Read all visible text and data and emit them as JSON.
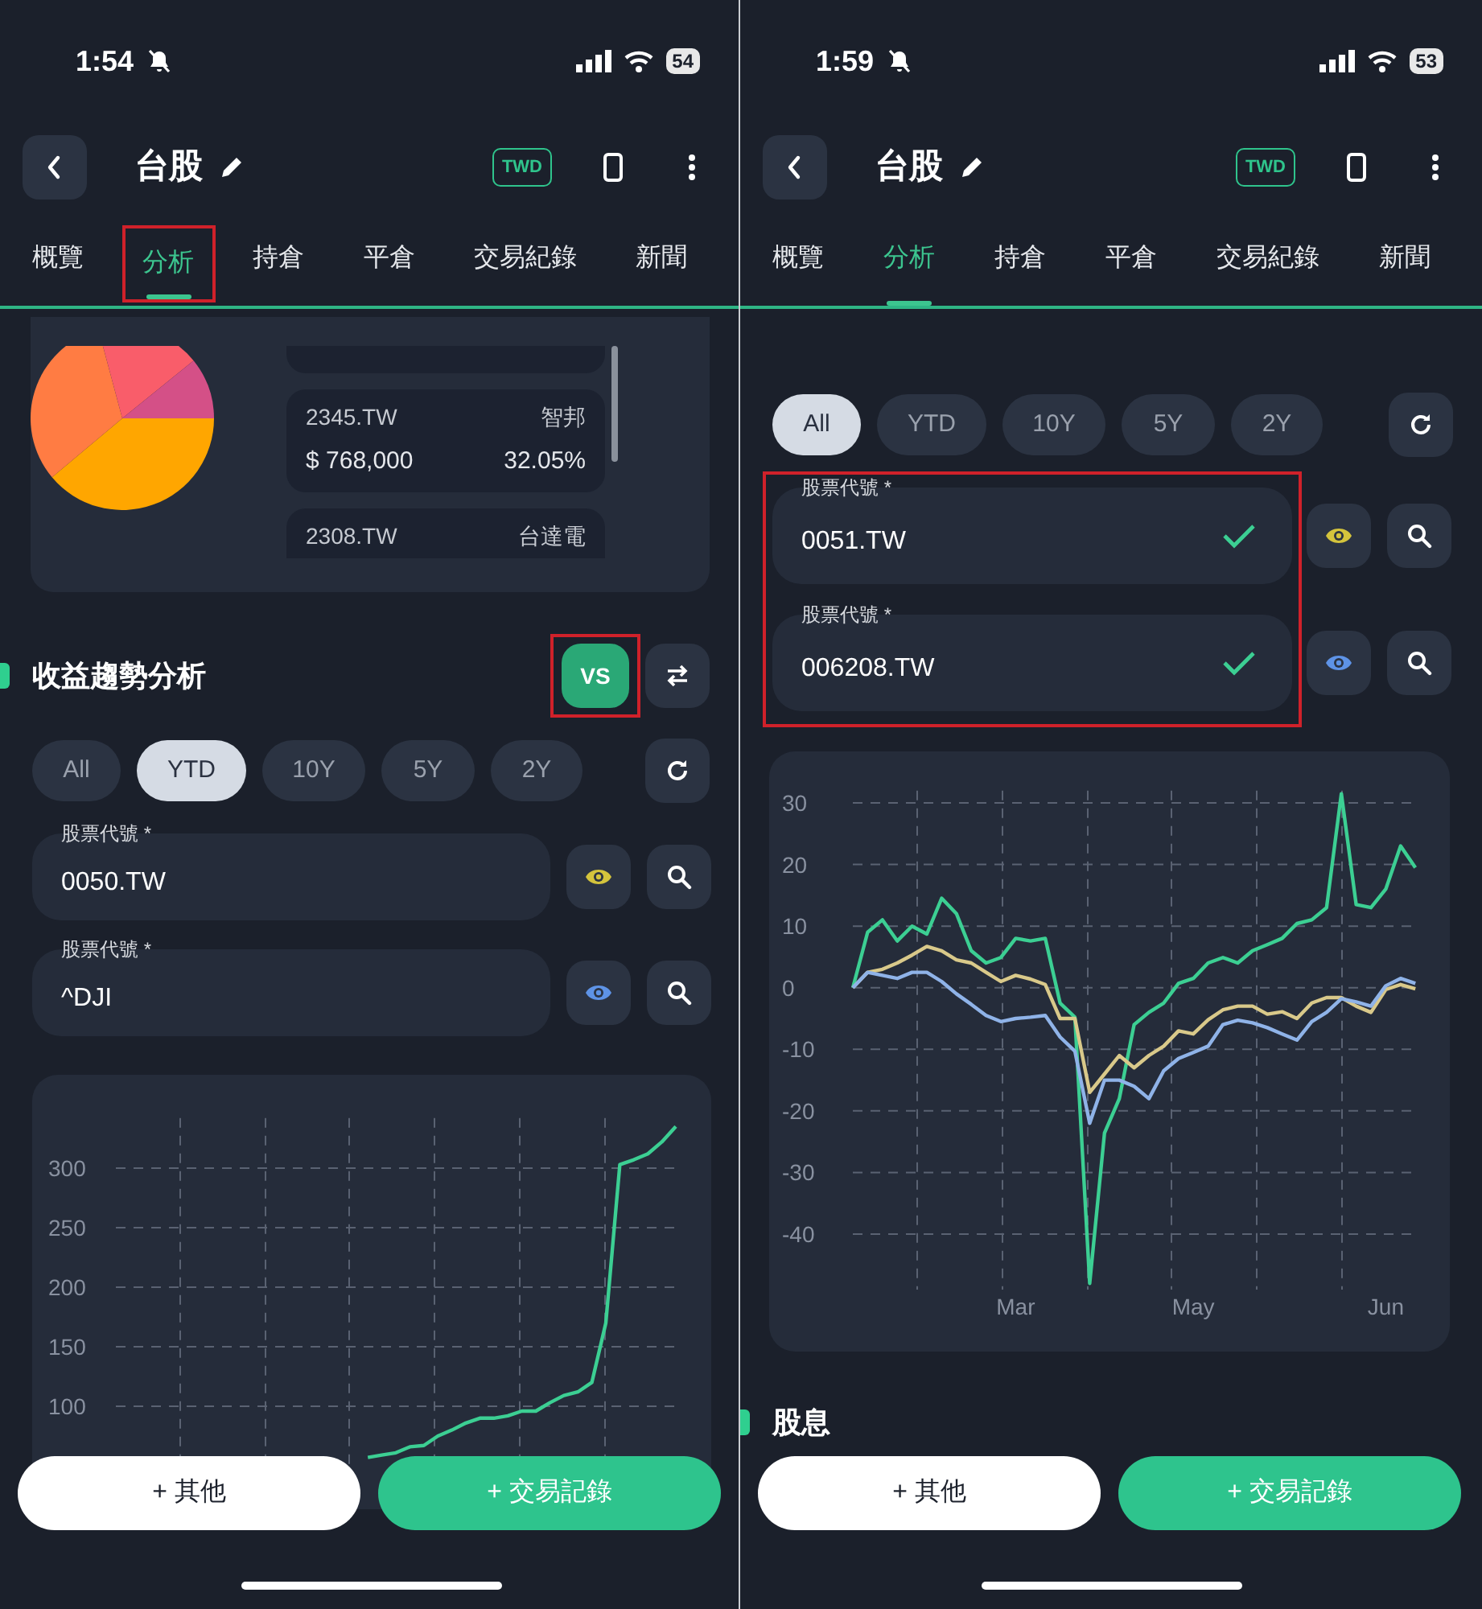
{
  "screens": [
    {
      "status_bar": {
        "time": "1:54",
        "battery": "54"
      },
      "header": {
        "title": "台股",
        "currency": "TWD"
      },
      "tabs": [
        {
          "label": "概覽",
          "selected": false,
          "highlighted": false
        },
        {
          "label": "分析",
          "selected": true,
          "highlighted": true
        },
        {
          "label": "持倉",
          "selected": false,
          "highlighted": false
        },
        {
          "label": "平倉",
          "selected": false,
          "highlighted": false
        },
        {
          "label": "交易紀錄",
          "selected": false,
          "highlighted": false
        },
        {
          "label": "新聞",
          "selected": false,
          "highlighted": false
        }
      ],
      "holdings": [
        {
          "symbol": "2345.TW",
          "name": "智邦",
          "amount": "$ 768,000",
          "percent": "32.05%"
        },
        {
          "symbol": "2308.TW",
          "name": "台達電"
        }
      ],
      "section_title": "收益趨勢分析",
      "vs_button": {
        "label": "VS",
        "on": true,
        "highlighted": true
      },
      "ranges": [
        {
          "label": "All",
          "selected": false
        },
        {
          "label": "YTD",
          "selected": true
        },
        {
          "label": "10Y",
          "selected": false
        },
        {
          "label": "5Y",
          "selected": false
        },
        {
          "label": "2Y",
          "selected": false
        }
      ],
      "tickers_highlighted": false,
      "tickers": [
        {
          "label": "股票代號 *",
          "value": "0050.TW",
          "verified": false,
          "color": "#d4c43c"
        },
        {
          "label": "股票代號 *",
          "value": "^DJI",
          "verified": false,
          "color": "#5e93e6"
        }
      ],
      "chart": {
        "chart_data": {
          "type": "line",
          "categories": [
            null,
            null,
            null,
            null,
            null,
            null,
            null,
            null,
            null,
            null,
            null,
            null,
            null,
            null,
            null,
            null,
            null,
            null,
            null,
            null,
            null,
            null,
            null,
            null,
            null,
            null,
            null,
            null,
            null,
            null,
            null,
            null,
            null,
            null,
            null,
            null,
            null,
            null,
            null,
            null,
            null
          ],
          "grid": true,
          "ylim": [
            14,
            342
          ],
          "yticks": [
            100,
            150,
            200,
            250,
            300
          ],
          "series": [
            {
              "color": "#3ccf93",
              "values": [
                null,
                null,
                null,
                null,
                null,
                null,
                null,
                null,
                null,
                null,
                null,
                null,
                null,
                null,
                null,
                null,
                null,
                null,
                57,
                59,
                61,
                66,
                67,
                75,
                80,
                86,
                90,
                90,
                92,
                96,
                96,
                103,
                109,
                112,
                120,
                170,
                303,
                307,
                312,
                322,
                335
              ]
            }
          ]
        }
      },
      "buttons": [
        {
          "label": "+ 其他",
          "kind": "secondary"
        },
        {
          "label": "+ 交易記錄",
          "kind": "primary"
        }
      ]
    },
    {
      "status_bar": {
        "time": "1:59",
        "battery": "53"
      },
      "header": {
        "title": "台股",
        "currency": "TWD"
      },
      "tabs": [
        {
          "label": "概覽",
          "selected": false,
          "highlighted": false
        },
        {
          "label": "分析",
          "selected": true,
          "highlighted": false
        },
        {
          "label": "持倉",
          "selected": false,
          "highlighted": false
        },
        {
          "label": "平倉",
          "selected": false,
          "highlighted": false
        },
        {
          "label": "交易紀錄",
          "selected": false,
          "highlighted": false
        },
        {
          "label": "新聞",
          "selected": false,
          "highlighted": false
        }
      ],
      "ranges": [
        {
          "label": "All",
          "selected": true
        },
        {
          "label": "YTD",
          "selected": false
        },
        {
          "label": "10Y",
          "selected": false
        },
        {
          "label": "5Y",
          "selected": false
        },
        {
          "label": "2Y",
          "selected": false
        }
      ],
      "tickers_highlighted": true,
      "tickers": [
        {
          "label": "股票代號 *",
          "value": "0051.TW",
          "verified": true,
          "color": "#d4c43c"
        },
        {
          "label": "股票代號 *",
          "value": "006208.TW",
          "verified": true,
          "color": "#5e93e6"
        }
      ],
      "chart": {
        "chart_data": {
          "type": "line",
          "categories": [
            null,
            null,
            null,
            null,
            null,
            null,
            null,
            null,
            null,
            null,
            null,
            "Mar",
            null,
            null,
            null,
            null,
            null,
            null,
            null,
            null,
            null,
            null,
            null,
            "May",
            null,
            null,
            null,
            null,
            null,
            null,
            null,
            null,
            null,
            null,
            null,
            null,
            "Jun",
            null,
            null
          ],
          "grid": true,
          "ylim": [
            -49,
            32
          ],
          "yticks": [
            30,
            20,
            10,
            0,
            -10,
            -20,
            -30,
            -40
          ],
          "series": [
            {
              "color": "#3ccf93",
              "values": [
                0,
                9,
                11,
                7.6,
                10,
                8.7,
                14.5,
                12,
                6,
                4,
                4.9,
                8,
                7.6,
                8,
                -2.5,
                -4.8,
                -48,
                -23.6,
                -18,
                -6,
                -4,
                -2.5,
                0.7,
                1.5,
                4,
                4.9,
                4,
                6,
                7,
                8,
                10.4,
                11,
                13,
                31.5,
                13.5,
                13,
                16,
                23,
                19.5
              ]
            },
            {
              "color": "#d9c98a",
              "values": [
                0,
                2.5,
                3,
                4,
                5.3,
                6.7,
                6,
                4.5,
                4,
                2.5,
                1,
                2,
                1.4,
                0.5,
                -5,
                -5,
                -17,
                -14,
                -11,
                -13,
                -11,
                -9.5,
                -7,
                -7.5,
                -5.2,
                -3.6,
                -3,
                -3,
                -4.3,
                -3.9,
                -5,
                -2.5,
                -1.6,
                -1.6,
                -3,
                -4,
                -0.3,
                0.5,
                -0.2
              ]
            },
            {
              "color": "#8fb3e8",
              "values": [
                0,
                2.5,
                2,
                1.5,
                2.5,
                2.5,
                1,
                -1,
                -2.7,
                -4.5,
                -5.5,
                -5,
                -4.8,
                -4.5,
                -8,
                -10.3,
                -22,
                -15,
                -15,
                -16,
                -18,
                -13.5,
                -11.5,
                -10.5,
                -9.5,
                -6,
                -5.3,
                -5.7,
                -6.5,
                -7.5,
                -8.5,
                -5.5,
                -4,
                -1.8,
                -2.3,
                -3,
                0.3,
                1.5,
                0.7
              ]
            }
          ]
        }
      },
      "footer_section": "股息",
      "buttons": [
        {
          "label": "+ 其他",
          "kind": "secondary"
        },
        {
          "label": "+ 交易記錄",
          "kind": "primary"
        }
      ]
    }
  ]
}
